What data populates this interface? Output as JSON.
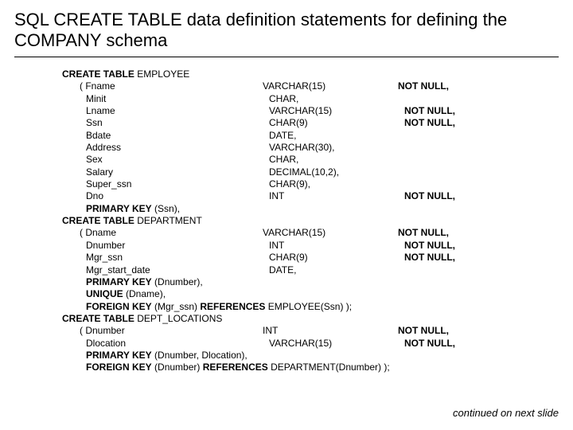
{
  "title": "SQL CREATE TABLE data definition statements for defining the COMPANY schema",
  "footer": "continued on next slide",
  "kw": {
    "ct": "CREATE TABLE",
    "pk": "PRIMARY KEY",
    "uq": "UNIQUE",
    "fk": "FOREIGN KEY",
    "ref": "REFERENCES",
    "nn": "NOT NULL,"
  },
  "t1": {
    "name": "EMPLOYEE",
    "cols": [
      {
        "n": "Fname",
        "t": "VARCHAR(15)",
        "c": "nn",
        "open": true
      },
      {
        "n": "Minit",
        "t": "CHAR,",
        "c": ""
      },
      {
        "n": "Lname",
        "t": "VARCHAR(15)",
        "c": "nn"
      },
      {
        "n": "Ssn",
        "t": "CHAR(9)",
        "c": "nn"
      },
      {
        "n": "Bdate",
        "t": "DATE,",
        "c": ""
      },
      {
        "n": "Address",
        "t": "VARCHAR(30),",
        "c": ""
      },
      {
        "n": "Sex",
        "t": "CHAR,",
        "c": ""
      },
      {
        "n": "Salary",
        "t": "DECIMAL(10,2),",
        "c": ""
      },
      {
        "n": "Super_ssn",
        "t": "CHAR(9),",
        "c": ""
      },
      {
        "n": "Dno",
        "t": "INT",
        "c": "nn"
      }
    ],
    "pk": "(Ssn),"
  },
  "t2": {
    "name": "DEPARTMENT",
    "cols": [
      {
        "n": "Dname",
        "t": "VARCHAR(15)",
        "c": "nn",
        "open": true
      },
      {
        "n": "Dnumber",
        "t": "INT",
        "c": "nn"
      },
      {
        "n": "Mgr_ssn",
        "t": "CHAR(9)",
        "c": "nn"
      },
      {
        "n": "Mgr_start_date",
        "t": "DATE,",
        "c": ""
      }
    ],
    "pk": "(Dnumber),",
    "uq": "(Dname),",
    "fk": "(Mgr_ssn)",
    "ref": "EMPLOYEE(Ssn) );"
  },
  "t3": {
    "name": "DEPT_LOCATIONS",
    "cols": [
      {
        "n": "Dnumber",
        "t": "INT",
        "c": "nn",
        "open": true
      },
      {
        "n": "Dlocation",
        "t": "VARCHAR(15)",
        "c": "nn"
      }
    ],
    "pk": "(Dnumber, Dlocation),",
    "fk": "(Dnumber)",
    "ref": "DEPARTMENT(Dnumber) );"
  }
}
